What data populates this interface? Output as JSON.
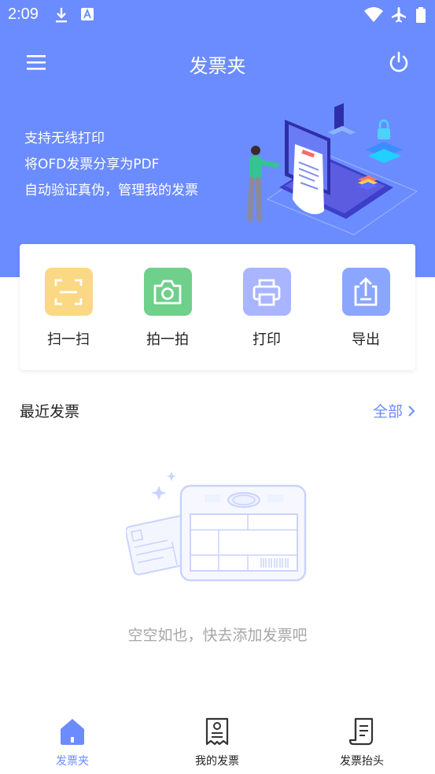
{
  "status_bar": {
    "time": "2:09"
  },
  "app_bar": {
    "title": "发票夹"
  },
  "hero": {
    "lines": [
      "支持无线打印",
      "将OFD发票分享为PDF",
      "自动验证真伪，管理我的发票"
    ]
  },
  "actions": [
    {
      "label": "扫一扫",
      "color": "#fbd883",
      "icon": "scan-icon"
    },
    {
      "label": "拍一拍",
      "color": "#6fd08b",
      "icon": "camera-icon"
    },
    {
      "label": "打印",
      "color": "#a9b5ff",
      "icon": "printer-icon"
    },
    {
      "label": "导出",
      "color": "#8aa6ff",
      "icon": "export-icon"
    }
  ],
  "recent": {
    "title": "最近发票",
    "view_all": "全部"
  },
  "empty": {
    "text": "空空如也，快去添加发票吧"
  },
  "tabbar": [
    {
      "label": "发票夹",
      "icon": "home-icon",
      "active": true
    },
    {
      "label": "我的发票",
      "icon": "invoice-icon",
      "active": false
    },
    {
      "label": "发票抬头",
      "icon": "invoice-header-icon",
      "active": false
    }
  ],
  "colors": {
    "primary": "#6b8cff",
    "text": "#222222",
    "muted": "#a7a7a7"
  }
}
